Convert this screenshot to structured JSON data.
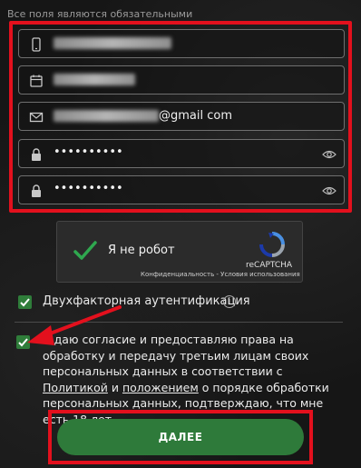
{
  "form": {
    "required_note": "Все поля являются обязательными",
    "phone_value": "",
    "birthdate_value": "",
    "email_suffix": "@gmail com",
    "password_mask": "••••••••••",
    "password_confirm_mask": "••••••••••"
  },
  "captcha": {
    "label": "Я не робот",
    "brand": "reCAPTCHA",
    "links": "Конфиденциальность - Условия использования"
  },
  "twofa": {
    "label": "Двухфакторная аутентификация",
    "info": "i"
  },
  "consent": {
    "part1": "Я даю согласие и предоставляю права на обработку и передачу третьим лицам своих персональных данных в соответствии с ",
    "policy_link": "Политикой",
    "part2": " и ",
    "rules_link": "положением",
    "part3": " о порядке обработки персональных данных, подтверждаю, что мне есть 18 лет"
  },
  "submit_label": "ДАЛЕЕ",
  "colors": {
    "accent_green": "#2e7a3a",
    "highlight_red": "#e3101d",
    "check_green": "#2fa84f"
  },
  "icons": [
    "phone-icon",
    "calendar-icon",
    "mail-icon",
    "lock-icon",
    "eye-icon",
    "recaptcha-logo-icon",
    "checkmark-icon",
    "info-icon"
  ]
}
